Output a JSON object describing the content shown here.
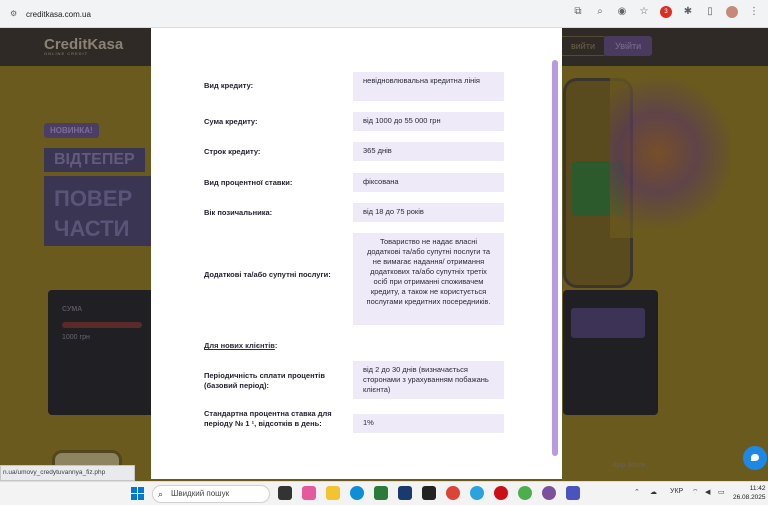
{
  "browser": {
    "url": "creditkasa.com.ua"
  },
  "site": {
    "logo": "CreditKasa",
    "logo_tagline": "ONLINE CREDIT",
    "header_btn_1": "вийти",
    "header_btn_2": "Увійти",
    "badge": "НОВИНКА!",
    "hero_line_1": "ВІДТЕПЕР",
    "hero_line_2": "ПОВЕР ЧАСТИ",
    "calc_label": "СУМА",
    "calc_value": "1000 грн",
    "app_store": "App Store",
    "status_link": "n.ua/umovy_credytuvannya_fiz.php"
  },
  "modal": {
    "rows": [
      {
        "label": "Вид кредиту:",
        "value": "невідновлювальна кредитна лінія"
      },
      {
        "label": "Сума кредиту:",
        "value": "від 1000 до 55 000 грн"
      },
      {
        "label": "Строк кредиту:",
        "value": "365 днів"
      },
      {
        "label": "Вид процентної ставки:",
        "value": "фіксована"
      },
      {
        "label": "Вік позичальника:",
        "value": "від 18 до 75 років"
      },
      {
        "label": "Додаткові та/або супутні послуги:",
        "value": "Товариство не надає власні додаткові та/або супутні послуги та не вимагає надання/ отримання додаткових та/або супутніх третіх осіб при отриманні споживачем кредиту, а також не користується послугами кредитних посередників."
      },
      {
        "label": "Періодичність сплати процентів (базовий період):",
        "value": "від 2 до 30 днів (визначається сторонами з урахуванням побажань клієнта)"
      },
      {
        "label": "Стандартна процентна ставка для періоду № 1 ¹, відсотків в день:",
        "value": "1%"
      }
    ],
    "new_clients_link": "Для нових клієнтів",
    "new_clients_suffix": ":"
  },
  "taskbar": {
    "search_placeholder": "Швидкий пошук",
    "lang": "УКР",
    "time": "11:42",
    "date": "26.08.2025"
  }
}
